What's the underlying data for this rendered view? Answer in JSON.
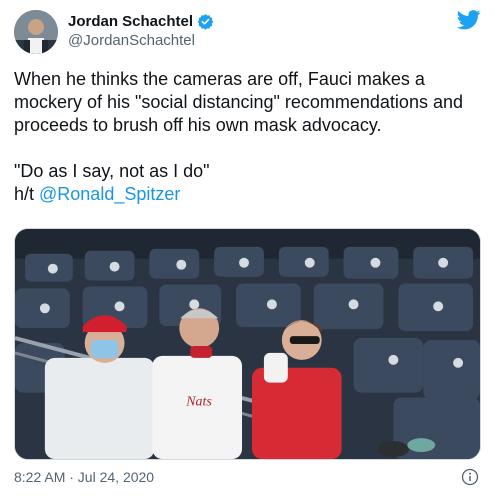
{
  "author": {
    "display_name": "Jordan Schachtel",
    "handle": "@JordanSchachtel",
    "verified_icon": "verified-badge-icon",
    "avatar": "avatar-photo"
  },
  "brand": {
    "icon": "twitter-bird-icon",
    "color": "#1da1f2"
  },
  "tweet": {
    "line1": "When he thinks the cameras are off, Fauci makes a mockery of his \"social distancing\" recommendations and proceeds to brush off his own mask advocacy.",
    "line2": "\"Do as I say, not as I do\"",
    "hat_tip_prefix": "h/t ",
    "mention": "@Ronald_Spitzer",
    "mention_color": "#1b95e0"
  },
  "media": {
    "type": "photo",
    "description_icon": "stadium-photo"
  },
  "footer": {
    "timestamp": "8:22 AM · Jul 24, 2020",
    "info_icon": "info-icon"
  }
}
